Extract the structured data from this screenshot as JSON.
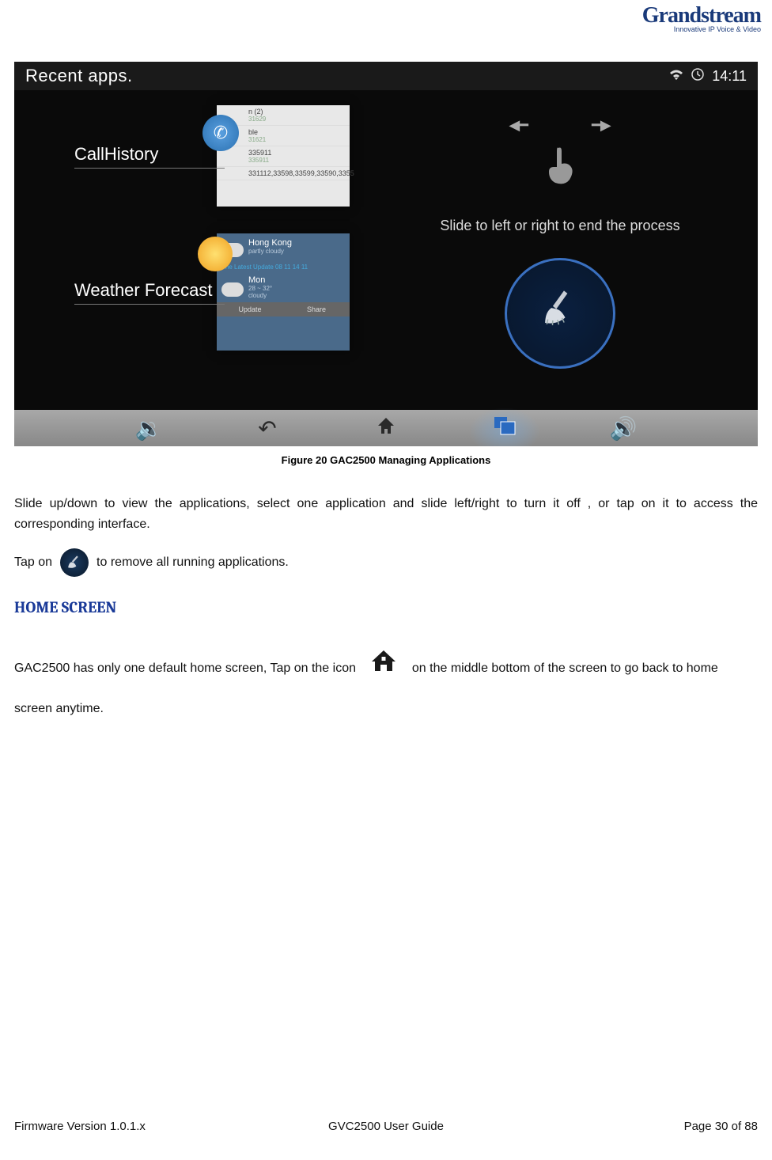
{
  "logo": {
    "brand": "Grandstream",
    "tagline": "Innovative IP Voice & Video"
  },
  "screenshot": {
    "status": {
      "title": "Recent apps.",
      "time": "14:11"
    },
    "apps": {
      "call": {
        "label": "CallHistory",
        "lines": [
          {
            "num": "n (2)",
            "sub": "31629"
          },
          {
            "num": "ble",
            "sub": "31621"
          },
          {
            "num": "335911",
            "sub": "335911"
          },
          {
            "num": "331112,33598,33599,33590,3355",
            "sub": ""
          }
        ]
      },
      "weather": {
        "label": "Weather Forecast",
        "city": "Hong Kong",
        "cond": "partly cloudy",
        "update_line": "The Latest Update 08 11 14 11",
        "day": "Mon",
        "range": "28 ~ 32°",
        "day_cond": "cloudy",
        "btn_update": "Update",
        "btn_share": "Share"
      }
    },
    "swipe_hint": "Slide to left or right to end the process"
  },
  "figure_caption": "Figure 20 GAC2500 Managing Applications",
  "para1": "Slide up/down to view the applications, select one application and slide left/right to turn it off , or tap on it to access the corresponding interface.",
  "tap": {
    "before": "Tap on",
    "after": "to remove all running applications."
  },
  "heading": "HOME SCREEN",
  "home": {
    "before": "GAC2500 has only one default home screen, Tap on the icon",
    "after": "on the middle bottom of the screen to go back to home screen anytime."
  },
  "footer": {
    "left": "Firmware Version 1.0.1.x",
    "center": "GVC2500 User Guide",
    "right": "Page 30 of 88"
  }
}
